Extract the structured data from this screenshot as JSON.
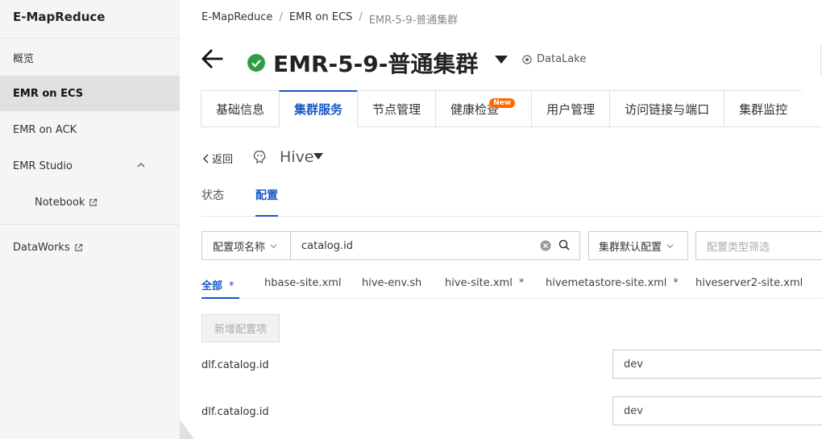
{
  "sidebar": {
    "title": "E-MapReduce",
    "items": [
      {
        "label": "概览"
      },
      {
        "label": "EMR on ECS"
      },
      {
        "label": "EMR on ACK"
      },
      {
        "label": "EMR Studio"
      },
      {
        "label": "Notebook"
      },
      {
        "label": "DataWorks"
      }
    ]
  },
  "breadcrumb": [
    "E-MapReduce",
    "EMR on ECS",
    "EMR-5-9-普通集群"
  ],
  "header": {
    "title": "EMR-5-9-普通集群",
    "tag": "DataLake",
    "status_color": "#2e9e45"
  },
  "tabs": [
    {
      "label": "基础信息"
    },
    {
      "label": "集群服务"
    },
    {
      "label": "节点管理"
    },
    {
      "label": "健康检查",
      "badge": "New"
    },
    {
      "label": "用户管理"
    },
    {
      "label": "访问链接与端口"
    },
    {
      "label": "集群监控"
    }
  ],
  "service": {
    "back_label": "返回",
    "name": "Hive"
  },
  "subtabs": [
    {
      "label": "状态"
    },
    {
      "label": "配置"
    }
  ],
  "filter": {
    "field_select": "配置项名称",
    "search_value": "catalog.id",
    "scope_select": "集群默认配置",
    "type_placeholder": "配置类型筛选"
  },
  "file_tabs": [
    {
      "label": "全部",
      "modified": "*"
    },
    {
      "label": "hbase-site.xml",
      "modified": ""
    },
    {
      "label": "hive-env.sh",
      "modified": ""
    },
    {
      "label": "hive-site.xml",
      "modified": "*"
    },
    {
      "label": "hivemetastore-site.xml",
      "modified": "*"
    },
    {
      "label": "hiveserver2-site.xml",
      "modified": ""
    }
  ],
  "add_button": "新增配置项",
  "config_rows": [
    {
      "key": "dlf.catalog.id",
      "value": "dev"
    },
    {
      "key": "dlf.catalog.id",
      "value": "dev"
    }
  ],
  "colors": {
    "accent": "#1a56c7",
    "badge": "#ff6a00"
  }
}
